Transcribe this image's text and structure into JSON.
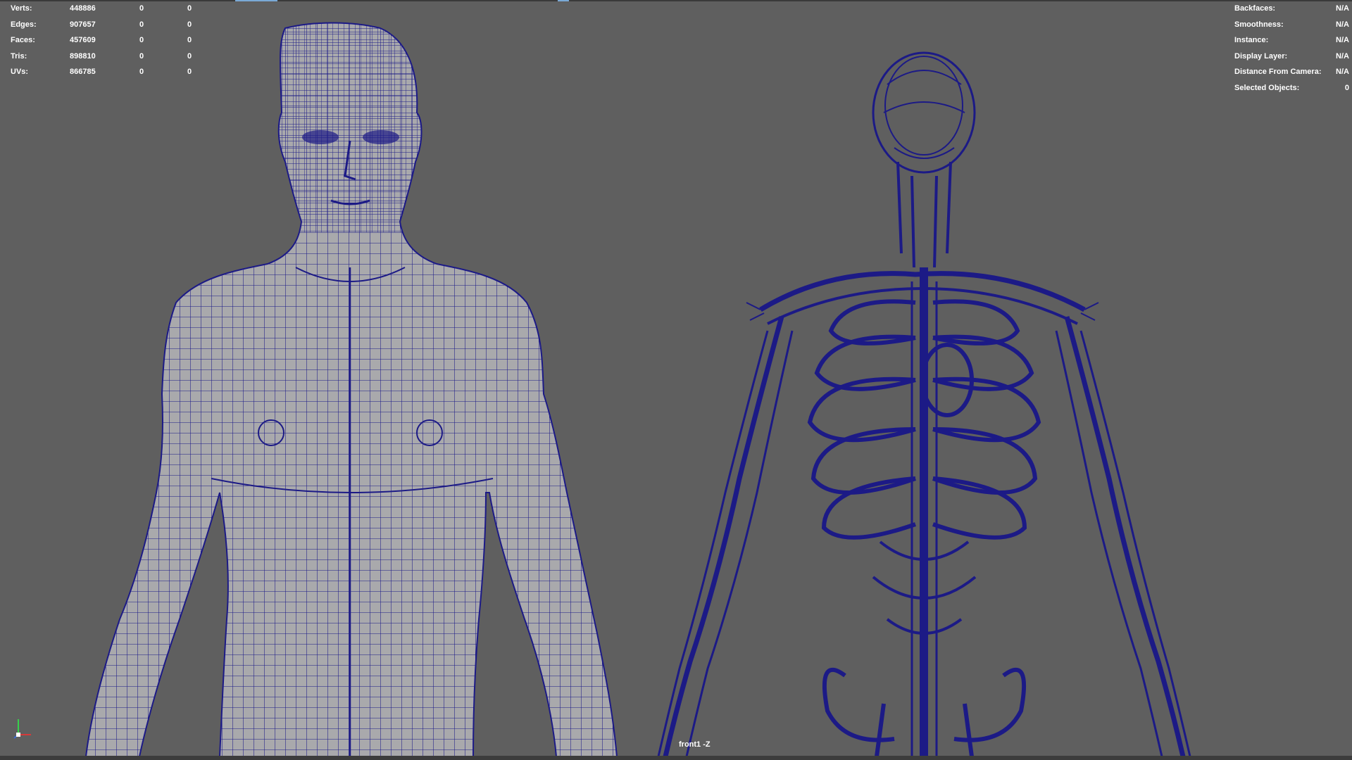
{
  "window": {
    "camera_label": "front1 -Z"
  },
  "poly_count": {
    "rows": [
      {
        "label": "Verts:",
        "total": "448886",
        "selected": "0",
        "selected_uv": "0"
      },
      {
        "label": "Edges:",
        "total": "907657",
        "selected": "0",
        "selected_uv": "0"
      },
      {
        "label": "Faces:",
        "total": "457609",
        "selected": "0",
        "selected_uv": "0"
      },
      {
        "label": "Tris:",
        "total": "898810",
        "selected": "0",
        "selected_uv": "0"
      },
      {
        "label": "UVs:",
        "total": "866785",
        "selected": "0",
        "selected_uv": "0"
      }
    ]
  },
  "object_details": {
    "rows": [
      {
        "label": "Backfaces:",
        "value": "N/A"
      },
      {
        "label": "Smoothness:",
        "value": "N/A"
      },
      {
        "label": "Instance:",
        "value": "N/A"
      },
      {
        "label": "Display Layer:",
        "value": "N/A"
      },
      {
        "label": "Distance From Camera:",
        "value": "N/A"
      },
      {
        "label": "Selected Objects:",
        "value": "0"
      }
    ]
  },
  "colors": {
    "viewport_bg": "#5f5f5f",
    "wireframe": "#1c1a86",
    "body_fill": "#a9a9ac",
    "hud_text": "#ffffff"
  },
  "icons": [
    "axis-xyz-icon"
  ]
}
